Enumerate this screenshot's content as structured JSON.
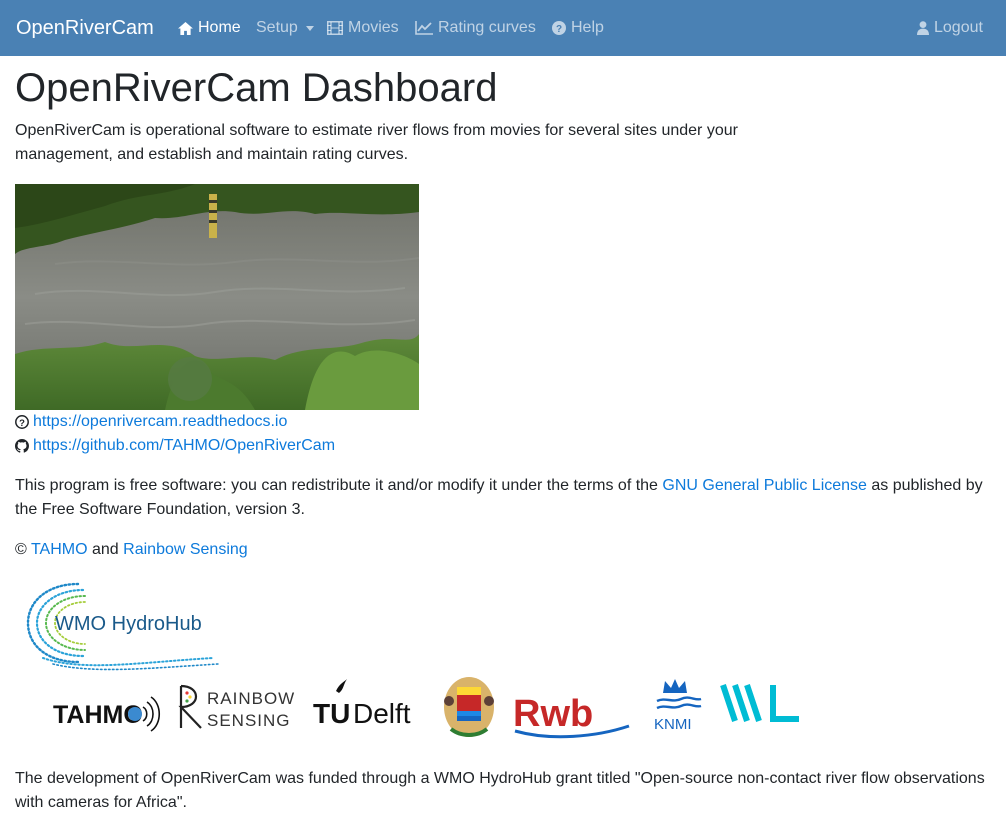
{
  "navbar": {
    "brand": "OpenRiverCam",
    "items": [
      {
        "label": "Home",
        "icon": "home-icon",
        "active": true
      },
      {
        "label": "Setup",
        "icon": "",
        "dropdown": true
      },
      {
        "label": "Movies",
        "icon": "film-icon"
      },
      {
        "label": "Rating curves",
        "icon": "line-chart-icon"
      },
      {
        "label": "Help",
        "icon": "question-circle-icon"
      }
    ],
    "logout": {
      "label": "Logout",
      "icon": "user-icon"
    },
    "colors": {
      "background": "#4a81b4",
      "text": "#ffffff",
      "muted": "rgba(255,255,255,0.65)"
    }
  },
  "main": {
    "title": "OpenRiverCam Dashboard",
    "intro": "OpenRiverCam is operational software to estimate river flows from movies for several sites under your management, and establish and maintain rating curves.",
    "links": [
      {
        "icon": "question-circle-icon",
        "text": "https://openrivercam.readthedocs.io"
      },
      {
        "icon": "github-icon",
        "text": "https://github.com/TAHMO/OpenRiverCam"
      }
    ],
    "license": {
      "before": "This program is free software: you can redistribute it and/or modify it under the terms of the ",
      "link": "GNU General Public License",
      "after": " as published by the Free Software Foundation, version 3."
    },
    "copyright": {
      "symbol": "©",
      "link1": "TAHMO",
      "and": "and",
      "link2": "Rainbow Sensing"
    },
    "logos": {
      "hydrohub": "WMO HydroHub",
      "tahmo": "TAHMO",
      "rainbow_top": "RAINBOW",
      "rainbow_bottom": "SENSING",
      "tudelft_tu": "TU",
      "tudelft_delft": "Delft",
      "rwb": "Rwb",
      "knmi": "KNMI",
      "wl": "WL"
    },
    "funding": "The development of OpenRiverCam was funded through a WMO HydroHub grant titled \"Open-source non-contact river flow observations with cameras for Africa\".",
    "link_color": "#0d7adb"
  }
}
